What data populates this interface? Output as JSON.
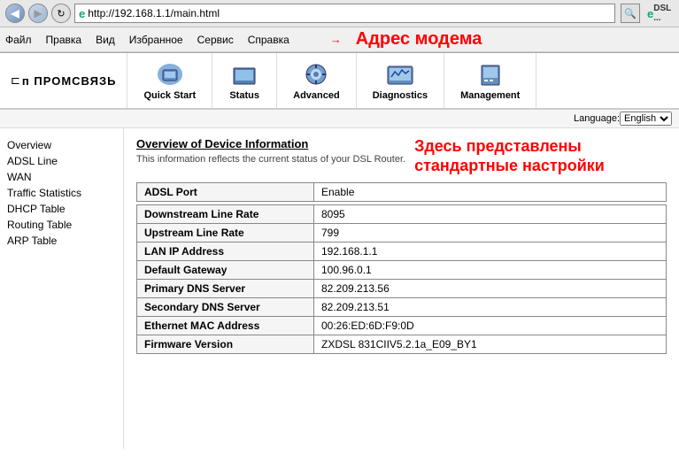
{
  "browser": {
    "address": "http://192.168.1.1/main.html",
    "back_icon": "◀",
    "refresh_icon": "↻",
    "search_icon": "🔍",
    "logo_text": "DSL ...",
    "ie_icon": "e"
  },
  "menu": {
    "items": [
      "Файл",
      "Правка",
      "Вид",
      "Избранное",
      "Сервис",
      "Справка"
    ],
    "annotation": "Адрес модема",
    "arrow": "→"
  },
  "header": {
    "logo": "п промсвязь",
    "nav_items": [
      {
        "label": "Quick Start",
        "icon": "quickstart"
      },
      {
        "label": "Status",
        "icon": "status"
      },
      {
        "label": "Advanced",
        "icon": "advanced"
      },
      {
        "label": "Diagnostics",
        "icon": "diagnostics"
      },
      {
        "label": "Management",
        "icon": "management"
      }
    ]
  },
  "language_bar": {
    "label": "Language:",
    "selected": "English",
    "options": [
      "English"
    ]
  },
  "sidebar": {
    "items": [
      "Overview",
      "ADSL Line",
      "WAN",
      "Traffic Statistics",
      "DHCP Table",
      "Routing Table",
      "ARP Table"
    ]
  },
  "content": {
    "title": "Overview of Device Information",
    "subtitle": "This information reflects the current status of your DSL Router.",
    "annotation_line1": "Здесь представлены",
    "annotation_line2": "стандартные настройки",
    "table": [
      {
        "label": "ADSL Port",
        "value": "Enable",
        "spacer_before": false
      },
      {
        "spacer": true
      },
      {
        "label": "Downstream Line Rate",
        "value": "8095"
      },
      {
        "label": "Upstream Line Rate",
        "value": "799"
      },
      {
        "label": "LAN IP Address",
        "value": "192.168.1.1"
      },
      {
        "label": "Default Gateway",
        "value": "100.96.0.1"
      },
      {
        "label": "Primary DNS Server",
        "value": "82.209.213.56"
      },
      {
        "label": "Secondary DNS Server",
        "value": "82.209.213.51"
      },
      {
        "label": "Ethernet MAC Address",
        "value": "00:26:ED:6D:F9:0D"
      },
      {
        "label": "Firmware Version",
        "value": "ZXDSL 831CIIV5.2.1a_E09_BY1"
      }
    ]
  }
}
